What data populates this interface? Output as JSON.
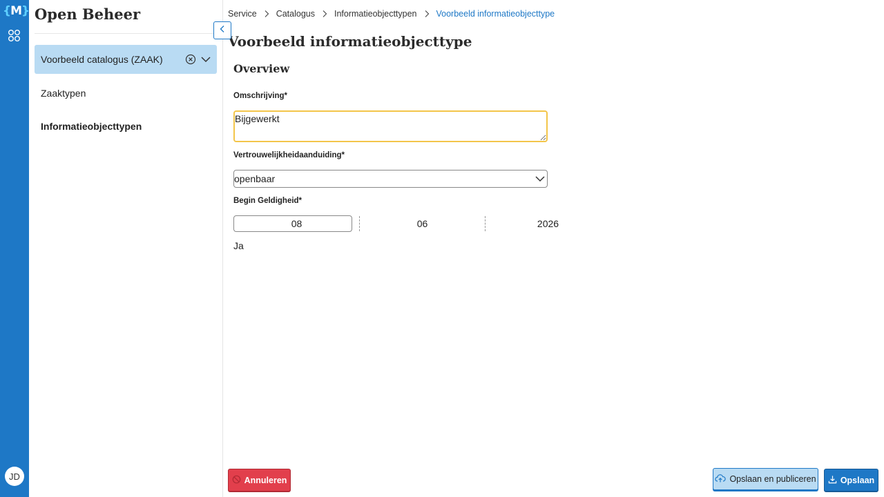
{
  "rail": {
    "logo": "M",
    "avatar_initials": "JD"
  },
  "sidebar": {
    "app_title": "Open Beheer",
    "catalog_selected": "Voorbeeld catalogus (ZAAK)",
    "items": [
      {
        "label": "Zaaktypen",
        "active": false
      },
      {
        "label": "Informatieobjecttypen",
        "active": true
      }
    ]
  },
  "breadcrumb": {
    "items": [
      "Service",
      "Catalogus",
      "Informatieobjecttypen"
    ],
    "current": "Voorbeeld informatieobjecttype"
  },
  "main": {
    "page_title": "Voorbeeld informatieobjecttype",
    "section_title": "Overview",
    "fields": {
      "omschrijving": {
        "label": "Omschrijving*",
        "value": "Bijgewerkt"
      },
      "vertrouwelijkheid": {
        "label": "Vertrouwelijkheidaanduiding*",
        "value": "openbaar"
      },
      "begin_geldigheid": {
        "label": "Begin Geldigheid*",
        "day": "08",
        "month": "06",
        "year": "2026"
      },
      "extra_value": "Ja"
    }
  },
  "footer": {
    "cancel_label": "Annuleren",
    "publish_label": "Opslaan en publiceren",
    "save_label": "Opslaan"
  },
  "colors": {
    "brand_blue": "#1e78c6",
    "selected_bg": "#b9dbf3",
    "danger": "#e23f4c",
    "focus": "#f3c54a"
  }
}
